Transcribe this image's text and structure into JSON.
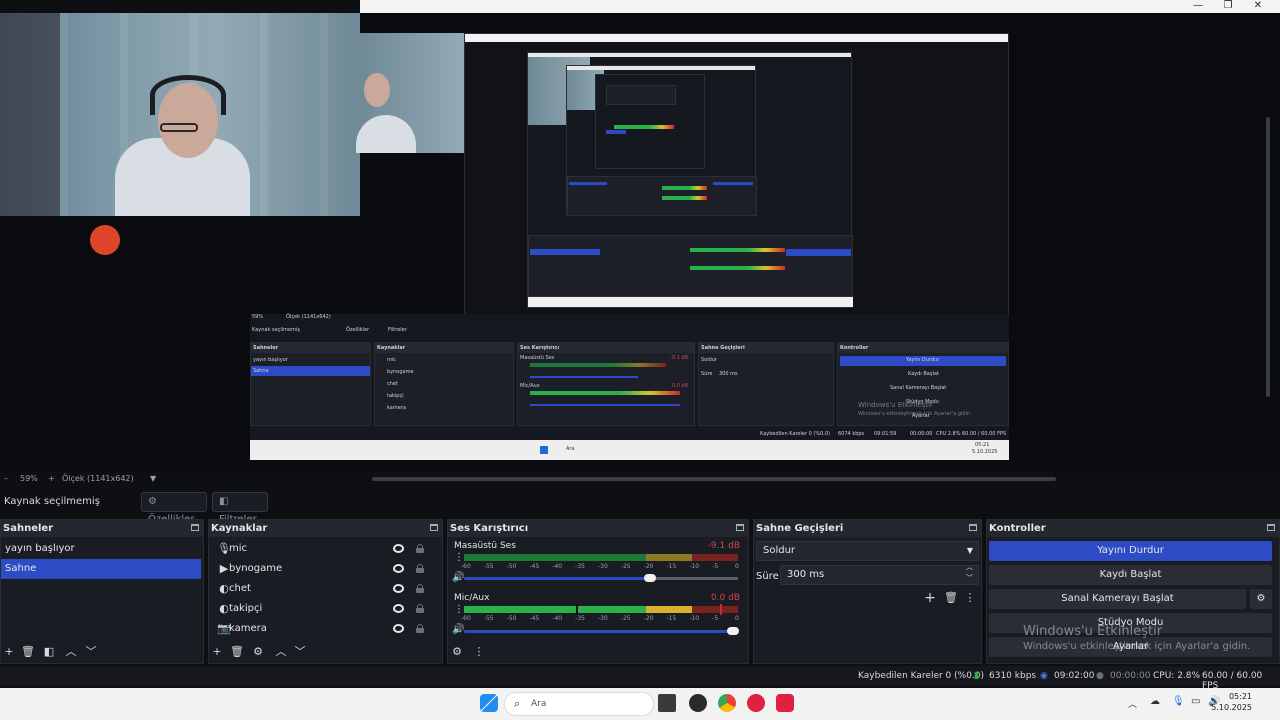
{
  "preview": {
    "zoom": "59%",
    "scale_label": "Ölçek (1141x642)"
  },
  "toolbar": {
    "no_source": "Kaynak seçilmemiş",
    "properties": "Özellikler",
    "filters": "Filtreler"
  },
  "scenes": {
    "title": "Sahneler",
    "items": [
      {
        "label": "yayın başlıyor"
      },
      {
        "label": "Sahne"
      }
    ]
  },
  "sources": {
    "title": "Kaynaklar",
    "items": [
      {
        "label": "mic",
        "icon": "microphone-icon"
      },
      {
        "label": "bynogame",
        "icon": "play-icon"
      },
      {
        "label": "chet",
        "icon": "browser-icon"
      },
      {
        "label": "takipçi",
        "icon": "browser-icon"
      },
      {
        "label": "kamera",
        "icon": "camera-icon"
      }
    ]
  },
  "mixer": {
    "title": "Ses Karıştırıcı",
    "channels": [
      {
        "name": "Masaüstü Ses",
        "db": "-9.1 dB",
        "volume": 0.68
      },
      {
        "name": "Mic/Aux",
        "db": "0.0 dB",
        "volume": 0.98
      }
    ],
    "scale": [
      "-60",
      "-55",
      "-50",
      "-45",
      "-40",
      "-35",
      "-30",
      "-25",
      "-20",
      "-15",
      "-10",
      "-5",
      "0"
    ]
  },
  "transitions": {
    "title": "Sahne Geçişleri",
    "type": "Soldur",
    "duration_label": "Süre",
    "duration_value": "300 ms"
  },
  "controls": {
    "title": "Kontroller",
    "stop_stream": "Yayını Durdur",
    "start_record": "Kaydı Başlat",
    "start_virtualcam": "Sanal Kamerayı Başlat",
    "studio_mode": "Stüdyo Modu",
    "settings": "Ayarlar"
  },
  "watermark": {
    "line1": "Windows'u Etkinleştir",
    "line2": "Windows'u etkinleştirmek için Ayarlar'a gidin."
  },
  "status": {
    "dropped": "Kaybedilen Kareler 0 (%0.0)",
    "bitrate": "6310 kbps",
    "live_time": "09:02:00",
    "rec_time": "00:00:00",
    "cpu": "CPU: 2.8%",
    "fps": "60.00 / 60.00 FPS"
  },
  "taskbar": {
    "search": "Ara",
    "time": "05:21",
    "date": "5.10.2025"
  },
  "inner": {
    "no_source": "Kaynak seçilmemiş",
    "properties": "Özellikler",
    "filters": "Filtreler",
    "scenes": "Sahneler",
    "sources": "Kaynaklar",
    "mixer": "Ses Karıştırıcı",
    "transitions": "Sahne Geçişleri",
    "controls": "Kontroller",
    "scene1": "yayın başlıyor",
    "scene2": "Sahne",
    "src1": "mic",
    "src2": "bynogame",
    "src3": "chet",
    "src4": "takipçi",
    "src5": "kamera",
    "mx1": "Masaüstü Ses",
    "mx2": "Mic/Aux",
    "trans": "Soldur",
    "dur_label": "Süre",
    "dur": "300 ms",
    "stop": "Yayını Durdur",
    "rec": "Kaydı Başlat",
    "vcam": "Sanal Kamerayı Başlat",
    "studio": "Stüdyo Modu",
    "settings": "Ayarlar",
    "zoom": "59%",
    "scale": "Ölçek (1141x642)",
    "search": "Ara",
    "dropped": "Kaybedilen Kareler 0 (%0.0)",
    "bitrate": "6074 kbps",
    "live_time": "09:01:59",
    "rec_time": "00:00:00",
    "cpu": "CPU 2.8%",
    "fps": "60.00 / 60.00 FPS",
    "wm1": "Windows'u Etkinleştir",
    "wm2": "Windows'u etkinleştirmek için Ayarlar'a gidin.",
    "db1": "-9.1 dB",
    "db2": "0.0 dB",
    "time": "05:21",
    "date": "5.10.2025"
  }
}
